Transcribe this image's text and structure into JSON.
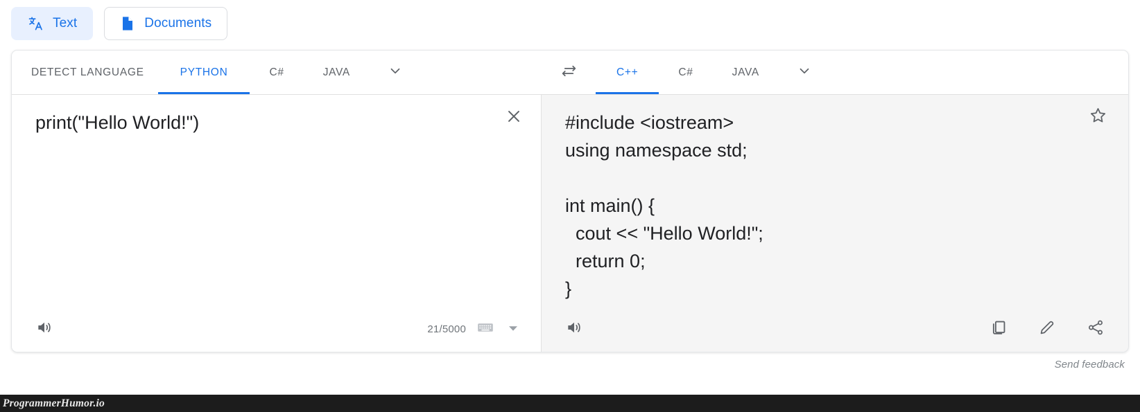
{
  "mode_bar": {
    "buttons": [
      {
        "label": "Text",
        "icon": "translate-icon",
        "active": true
      },
      {
        "label": "Documents",
        "icon": "document-icon",
        "active": false
      }
    ]
  },
  "source_panel": {
    "tabs": [
      {
        "label": "DETECT LANGUAGE",
        "selected": false
      },
      {
        "label": "PYTHON",
        "selected": true
      },
      {
        "label": "C#",
        "selected": false
      },
      {
        "label": "JAVA",
        "selected": false
      }
    ],
    "more_icon": "chevron-down-icon",
    "text": "print(\"Hello World!\")",
    "clear_icon": "close-icon",
    "listen_icon": "volume-up-icon",
    "char_count": "21/5000",
    "keyboard_icon": "keyboard-icon",
    "keyboard_caret_icon": "caret-down-icon"
  },
  "swap": {
    "icon": "swap-horizontal-icon"
  },
  "target_panel": {
    "tabs": [
      {
        "label": "C++",
        "selected": true
      },
      {
        "label": "C#",
        "selected": false
      },
      {
        "label": "JAVA",
        "selected": false
      }
    ],
    "more_icon": "chevron-down-icon",
    "text": "#include <iostream>\nusing namespace std;\n\nint main() {\n  cout << \"Hello World!\";\n  return 0;\n}",
    "star_icon": "star-outline-icon",
    "listen_icon": "volume-up-icon",
    "copy_icon": "copy-icon",
    "edit_icon": "pencil-icon",
    "share_icon": "share-icon"
  },
  "footer": {
    "feedback_label": "Send feedback"
  },
  "watermark": {
    "label": "ProgrammerHumor.io"
  },
  "colors": {
    "accent": "#1a73e8",
    "accent_bg": "#e8f0fe",
    "icon_gray": "#5f6368",
    "text": "#202124",
    "target_bg": "#f5f5f5",
    "watermark_bg": "#1c1c1c"
  }
}
